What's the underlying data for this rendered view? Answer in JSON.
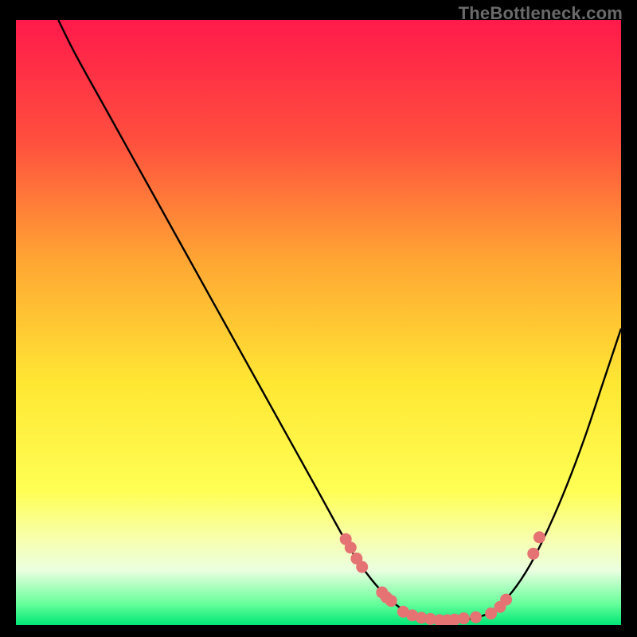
{
  "watermark": "TheBottleneck.com",
  "gradient": {
    "stops": [
      {
        "offset": 0.0,
        "color": "#ff1a4b"
      },
      {
        "offset": 0.2,
        "color": "#ff4f3e"
      },
      {
        "offset": 0.4,
        "color": "#ffa733"
      },
      {
        "offset": 0.6,
        "color": "#ffe733"
      },
      {
        "offset": 0.78,
        "color": "#ffff55"
      },
      {
        "offset": 0.86,
        "color": "#f7ffb0"
      },
      {
        "offset": 0.91,
        "color": "#eaffe0"
      },
      {
        "offset": 0.965,
        "color": "#66ff9a"
      },
      {
        "offset": 1.0,
        "color": "#00e676"
      }
    ]
  },
  "curve_color": "#000000",
  "marker_color": "#e57373",
  "plot_extent": {
    "xmin": 0,
    "xmax": 100,
    "ymin": 0,
    "ymax": 100
  },
  "chart_data": {
    "type": "line",
    "title": "",
    "xlabel": "",
    "ylabel": "",
    "xlim": [
      0,
      100
    ],
    "ylim": [
      0,
      100
    ],
    "series": [
      {
        "name": "curve",
        "x": [
          7,
          10,
          15,
          20,
          25,
          30,
          35,
          40,
          45,
          50,
          55,
          58,
          61,
          64,
          67,
          70,
          73,
          76,
          79,
          82,
          85,
          88,
          91,
          94,
          97,
          100
        ],
        "y": [
          100,
          94,
          85,
          76,
          67,
          58,
          49,
          40,
          31,
          22,
          13,
          8.5,
          5,
          2.5,
          1.2,
          0.8,
          0.8,
          1.2,
          2.5,
          5.5,
          10,
          16,
          23,
          31,
          40,
          49
        ]
      }
    ],
    "markers": {
      "name": "highlighted-points",
      "x": [
        54.5,
        55.3,
        56.3,
        57.2,
        60.5,
        61.2,
        62,
        64,
        65.5,
        67,
        68.5,
        70,
        71.3,
        72.5,
        74,
        76,
        78.5,
        80,
        81,
        85.5,
        86.5
      ],
      "y": [
        14.2,
        12.8,
        11,
        9.6,
        5.4,
        4.6,
        4,
        2.2,
        1.6,
        1.2,
        1,
        0.8,
        0.8,
        0.9,
        1.1,
        1.3,
        1.9,
        3,
        4.2,
        11.8,
        14.5
      ]
    }
  }
}
